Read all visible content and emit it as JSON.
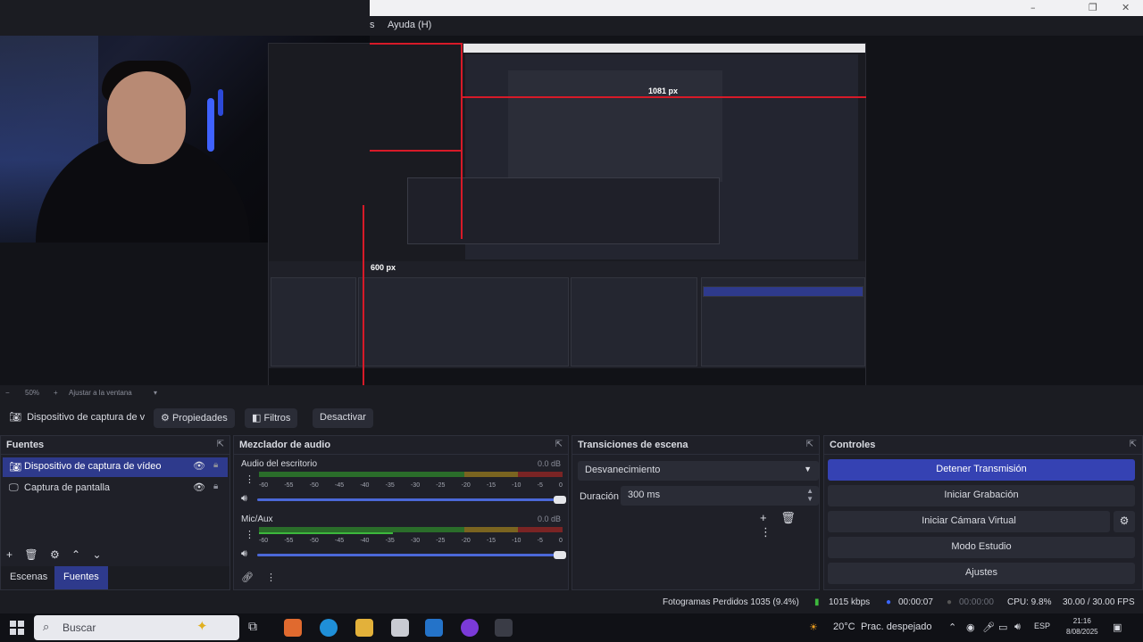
{
  "menubar": {
    "partial_item": "s",
    "help": "Ayuda (H)"
  },
  "window_controls": {
    "minimize": "–",
    "maximize": "❐",
    "close": "✕"
  },
  "preview": {
    "label_width": "1081 px",
    "label_height": "600 px"
  },
  "zoom": {
    "value": "50%",
    "fit_label": "Ajustar a la ventana"
  },
  "source_toolbar": {
    "selected_source": "Dispositivo de captura de v",
    "properties": "Propiedades",
    "filters": "Filtros",
    "deactivate": "Desactivar"
  },
  "fuentes": {
    "title": "Fuentes",
    "items": [
      {
        "label": "Dispositivo de captura de vídeo",
        "icon": "camera-icon",
        "selected": true
      },
      {
        "label": "Captura de pantalla",
        "icon": "monitor-icon",
        "selected": false
      }
    ],
    "tabs": [
      "Escenas",
      "Fuentes"
    ],
    "active_tab": "Fuentes"
  },
  "mixer": {
    "title": "Mezclador de audio",
    "channels": [
      {
        "name": "Audio del escritorio",
        "db": "0.0 dB",
        "level": 0.55
      },
      {
        "name": "Mic/Aux",
        "db": "0.0 dB",
        "level": 0.45
      }
    ],
    "scale": [
      "-60",
      "-55",
      "-50",
      "-45",
      "-40",
      "-35",
      "-30",
      "-25",
      "-20",
      "-15",
      "-10",
      "-5",
      "0"
    ]
  },
  "transitions": {
    "title": "Transiciones de escena",
    "selected": "Desvanecimiento",
    "duration_label": "Duración",
    "duration_value": "300 ms"
  },
  "controls": {
    "title": "Controles",
    "stop_stream": "Detener Transmisión",
    "start_recording": "Iniciar Grabación",
    "start_virtual_cam": "Iniciar Cámara Virtual",
    "studio_mode": "Modo Estudio",
    "settings": "Ajustes"
  },
  "status": {
    "dropped_frames": "Fotogramas Perdidos 1035 (9.4%)",
    "bitrate": "1015 kbps",
    "stream_time": "00:00:07",
    "rec_time": "00:00:00",
    "cpu": "CPU: 9.8%",
    "fps": "30.00 / 30.00 FPS"
  },
  "taskbar": {
    "search_placeholder": "Buscar",
    "weather": "20°C",
    "weather_desc": "Prac. despejado",
    "lang": "ESP",
    "time": "21:16",
    "date": "8/08/2025"
  },
  "colors": {
    "accent": "#3542b3",
    "selected": "#2e3a8c",
    "background": "#1b1c22",
    "dock": "#1f2028",
    "highlight_line": "#d71a28"
  }
}
